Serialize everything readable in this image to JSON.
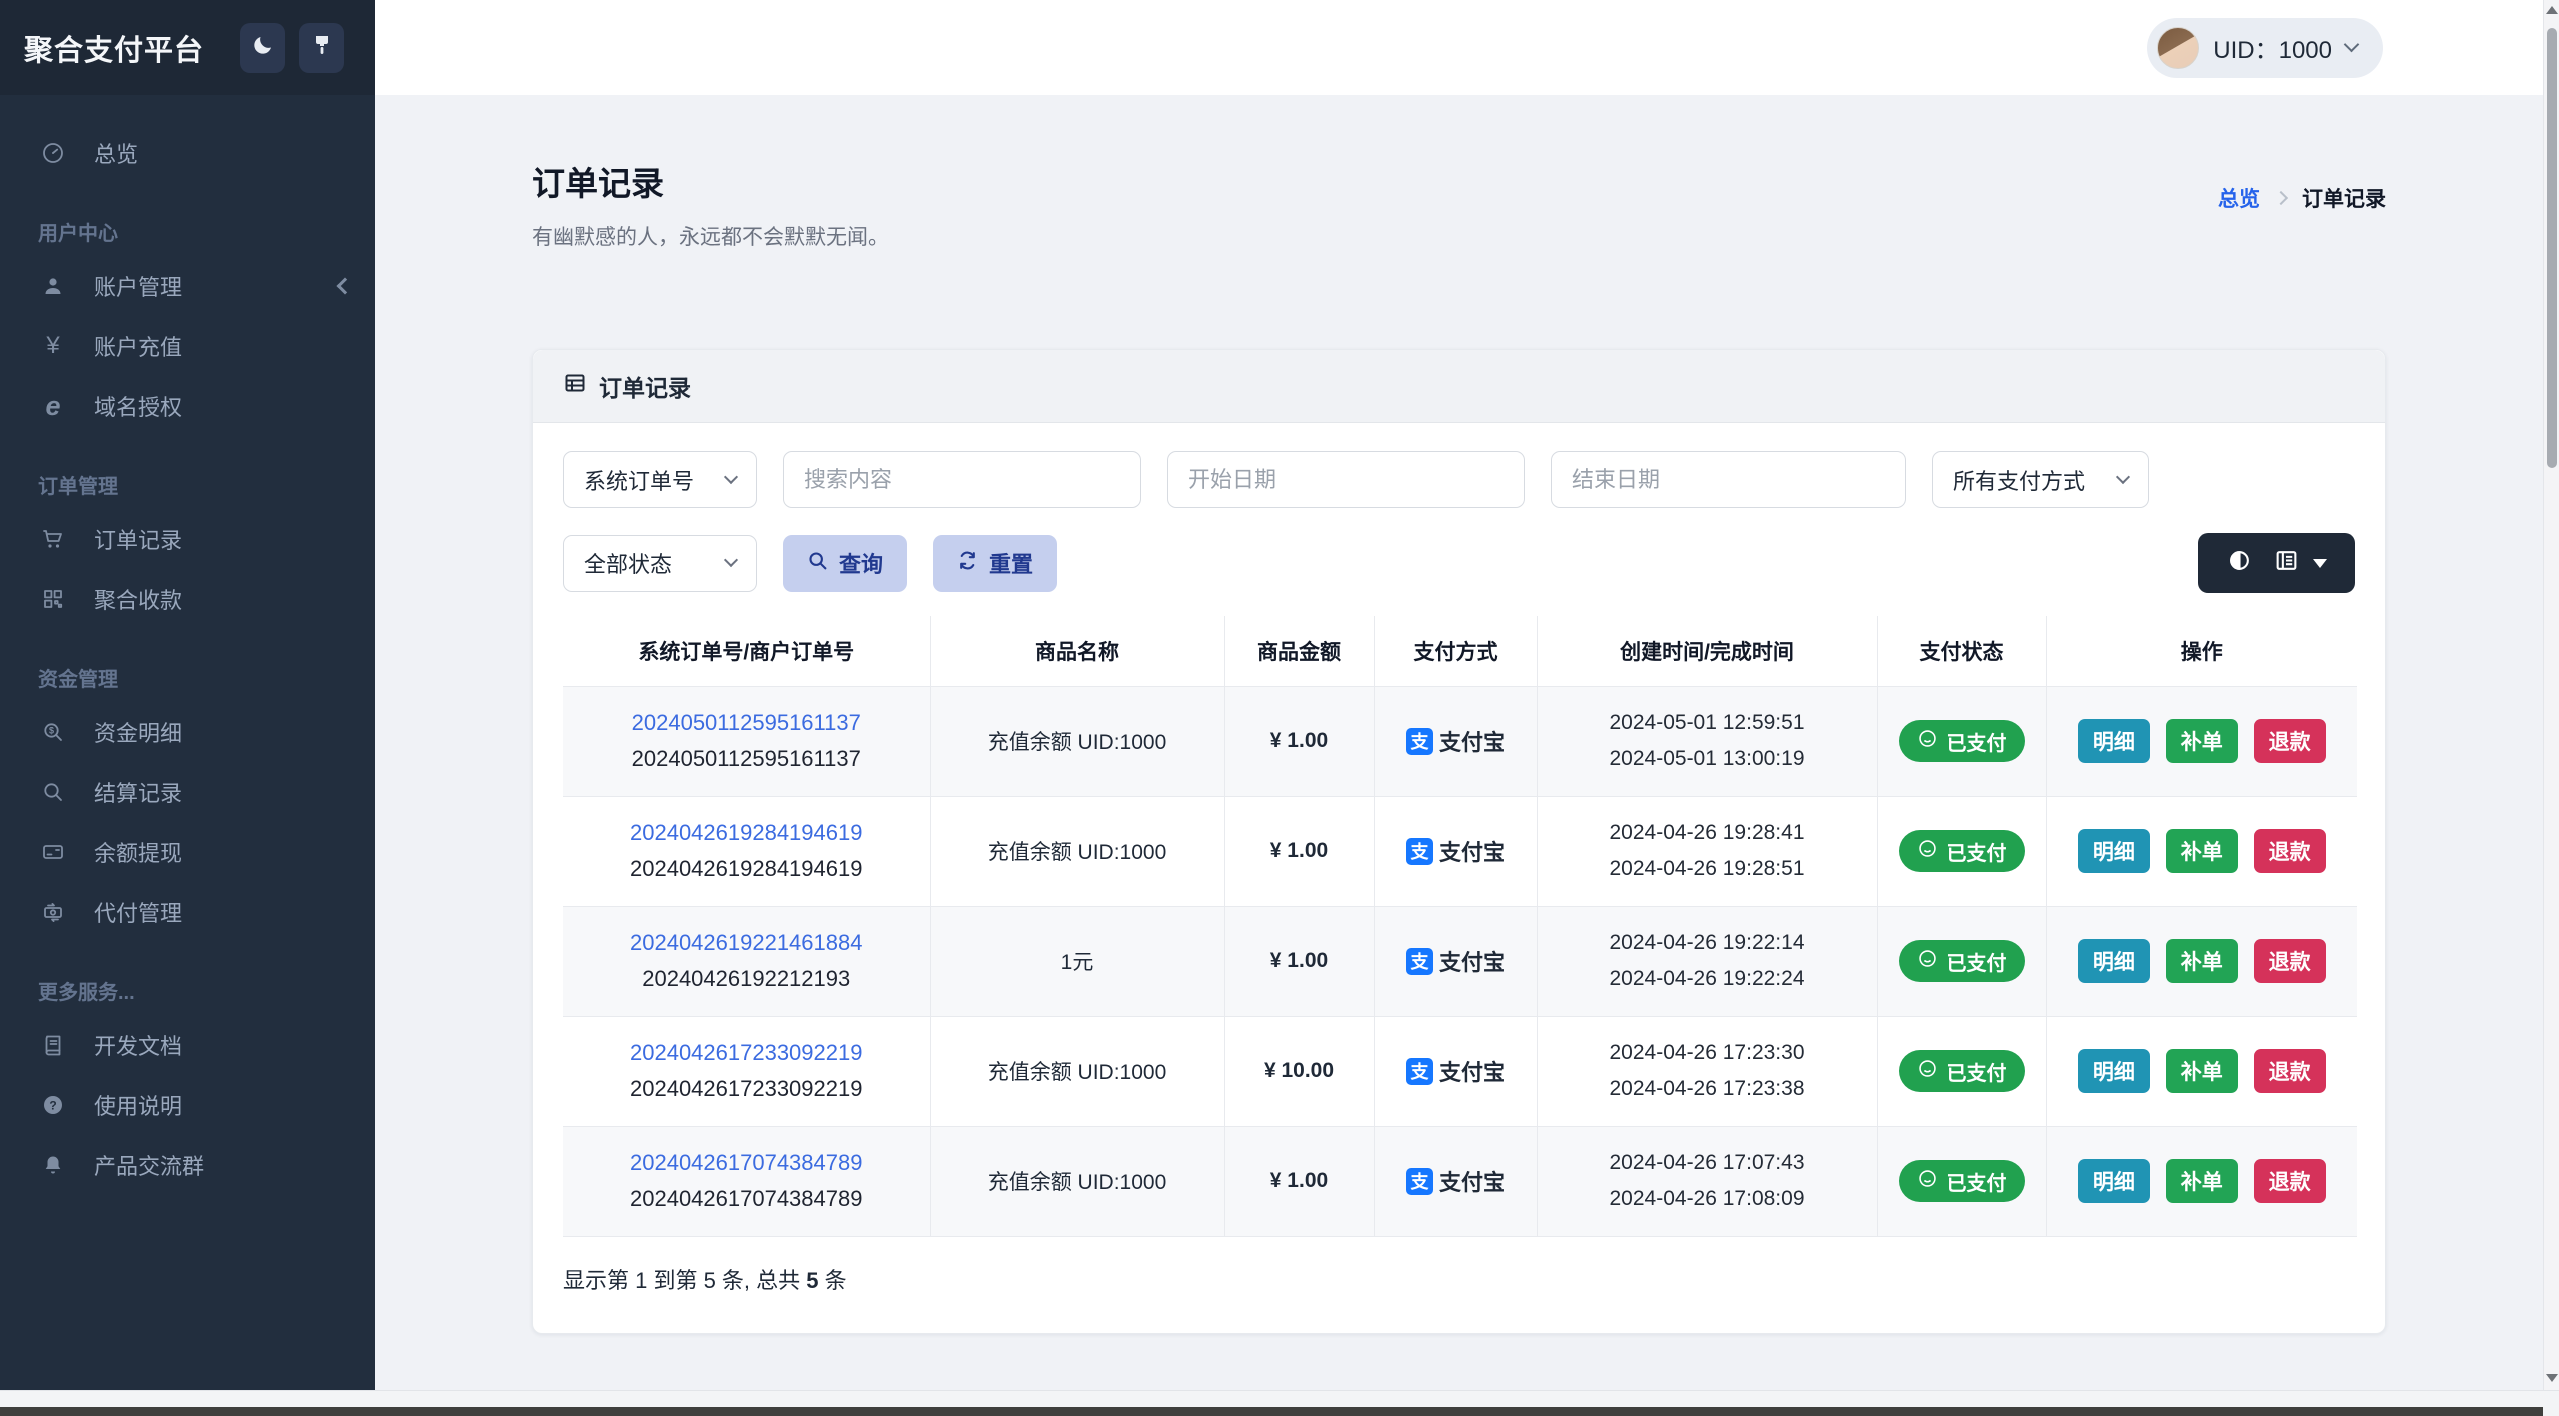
{
  "brand": {
    "title": "聚合支付平台"
  },
  "topbar": {
    "uid_label": "UID：1000"
  },
  "sidebar": {
    "overview_label": "总览",
    "sections": [
      {
        "label": "用户中心",
        "items": [
          {
            "label": "账户管理"
          },
          {
            "label": "账户充值"
          },
          {
            "label": "域名授权"
          }
        ]
      },
      {
        "label": "订单管理",
        "items": [
          {
            "label": "订单记录"
          },
          {
            "label": "聚合收款"
          }
        ]
      },
      {
        "label": "资金管理",
        "items": [
          {
            "label": "资金明细"
          },
          {
            "label": "结算记录"
          },
          {
            "label": "余额提现"
          },
          {
            "label": "代付管理"
          }
        ]
      },
      {
        "label": "更多服务...",
        "items": [
          {
            "label": "开发文档"
          },
          {
            "label": "使用说明"
          },
          {
            "label": "产品交流群"
          }
        ]
      }
    ]
  },
  "page": {
    "title": "订单记录",
    "subtitle": "有幽默感的人，永远都不会默默无闻。",
    "breadcrumb": {
      "home": "总览",
      "current": "订单记录"
    }
  },
  "card": {
    "header_title": "订单记录"
  },
  "filters": {
    "search_type_value": "系统订单号",
    "search_placeholder": "搜索内容",
    "start_date_placeholder": "开始日期",
    "end_date_placeholder": "结束日期",
    "pay_method_value": "所有支付方式",
    "status_value": "全部状态",
    "query_label": "查询",
    "reset_label": "重置"
  },
  "table": {
    "columns": [
      "系统订单号/商户订单号",
      "商品名称",
      "商品金额",
      "支付方式",
      "创建时间/完成时间",
      "支付状态",
      "操作"
    ],
    "rows": [
      {
        "sys_no": "2024050112595161137",
        "mch_no": "2024050112595161137",
        "product": "充值余额 UID:1000",
        "amount": "¥ 1.00",
        "pay_method": "支付宝",
        "created": "2024-05-01 12:59:51",
        "completed": "2024-05-01 13:00:19",
        "status": "已支付",
        "actions": [
          "明细",
          "补单",
          "退款"
        ]
      },
      {
        "sys_no": "2024042619284194619",
        "mch_no": "2024042619284194619",
        "product": "充值余额 UID:1000",
        "amount": "¥ 1.00",
        "pay_method": "支付宝",
        "created": "2024-04-26 19:28:41",
        "completed": "2024-04-26 19:28:51",
        "status": "已支付",
        "actions": [
          "明细",
          "补单",
          "退款"
        ]
      },
      {
        "sys_no": "2024042619221461884",
        "mch_no": "20240426192212193",
        "product": "1元",
        "amount": "¥ 1.00",
        "pay_method": "支付宝",
        "created": "2024-04-26 19:22:14",
        "completed": "2024-04-26 19:22:24",
        "status": "已支付",
        "actions": [
          "明细",
          "补单",
          "退款"
        ]
      },
      {
        "sys_no": "2024042617233092219",
        "mch_no": "2024042617233092219",
        "product": "充值余额 UID:1000",
        "amount": "¥ 10.00",
        "pay_method": "支付宝",
        "created": "2024-04-26 17:23:30",
        "completed": "2024-04-26 17:23:38",
        "status": "已支付",
        "actions": [
          "明细",
          "补单",
          "退款"
        ]
      },
      {
        "sys_no": "2024042617074384789",
        "mch_no": "2024042617074384789",
        "product": "充值余额 UID:1000",
        "amount": "¥ 1.00",
        "pay_method": "支付宝",
        "created": "2024-04-26 17:07:43",
        "completed": "2024-04-26 17:08:09",
        "status": "已支付",
        "actions": [
          "明细",
          "补单",
          "退款"
        ]
      }
    ],
    "alipay_glyph": "支",
    "footer_prefix": "显示第 1 到第 5 条, 总共 ",
    "footer_total": "5",
    "footer_suffix": " 条"
  },
  "colors": {
    "sidebar_bg": "#222e3e",
    "brand_bg": "#1e2836",
    "header_bg": "#ffffff",
    "page_bg": "#f0f2f6",
    "link_blue": "#3b6be0",
    "breadcrumb_blue": "#2563eb",
    "alipay_blue": "#1677ff",
    "badge_green": "#21a14f",
    "btn_teal": "#2094b4",
    "btn_green": "#22a455",
    "btn_red": "#d5325a",
    "primary_btn_bg": "#c5cfee",
    "primary_btn_text": "#21398f",
    "dark_group_bg": "#1f2937"
  }
}
